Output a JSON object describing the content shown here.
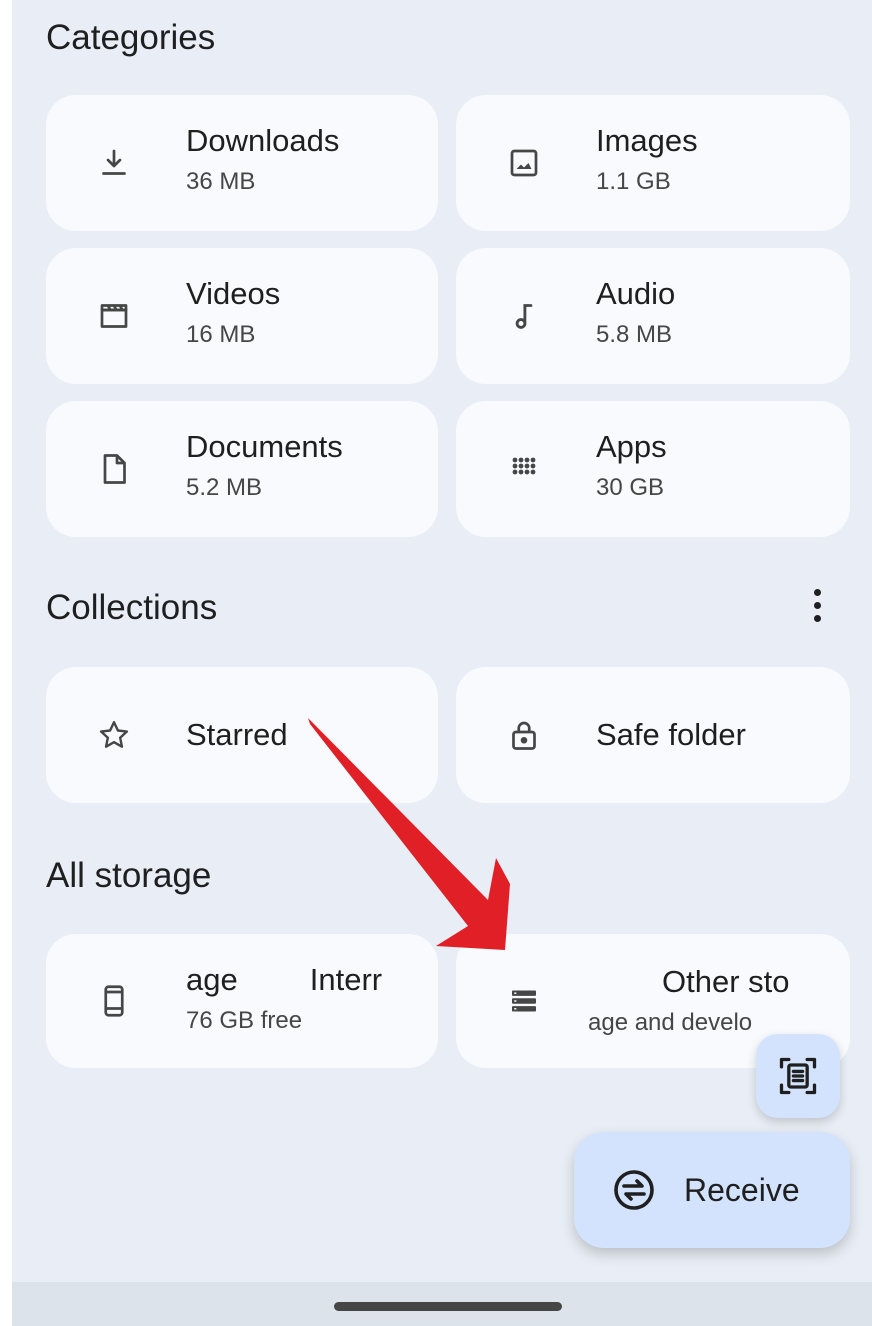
{
  "sections": {
    "categories_title": "Categories",
    "collections_title": "Collections",
    "all_storage_title": "All storage"
  },
  "categories": [
    {
      "label": "Downloads",
      "size": "36 MB",
      "icon": "download-icon"
    },
    {
      "label": "Images",
      "size": "1.1 GB",
      "icon": "image-icon"
    },
    {
      "label": "Videos",
      "size": "16 MB",
      "icon": "video-icon"
    },
    {
      "label": "Audio",
      "size": "5.8 MB",
      "icon": "music-note-icon"
    },
    {
      "label": "Documents",
      "size": "5.2 MB",
      "icon": "document-icon"
    },
    {
      "label": "Apps",
      "size": "30 GB",
      "icon": "apps-grid-icon"
    }
  ],
  "collections": [
    {
      "label": "Starred",
      "icon": "star-icon"
    },
    {
      "label": "Safe folder",
      "icon": "lock-icon"
    }
  ],
  "storage": [
    {
      "label_a": "age",
      "label_b": "Interr",
      "sub": "76 GB free",
      "icon": "phone-icon"
    },
    {
      "label": "Other sto",
      "sub": "age and develo",
      "icon": "storage-list-icon"
    }
  ],
  "fab": {
    "receive_label": "Receive",
    "scan_icon": "document-scan-icon",
    "receive_icon": "swap-circle-icon"
  },
  "colors": {
    "background": "#e9eef6",
    "card": "#f8fafd",
    "fab": "#d3e3fd",
    "arrow": "#e01f26"
  }
}
